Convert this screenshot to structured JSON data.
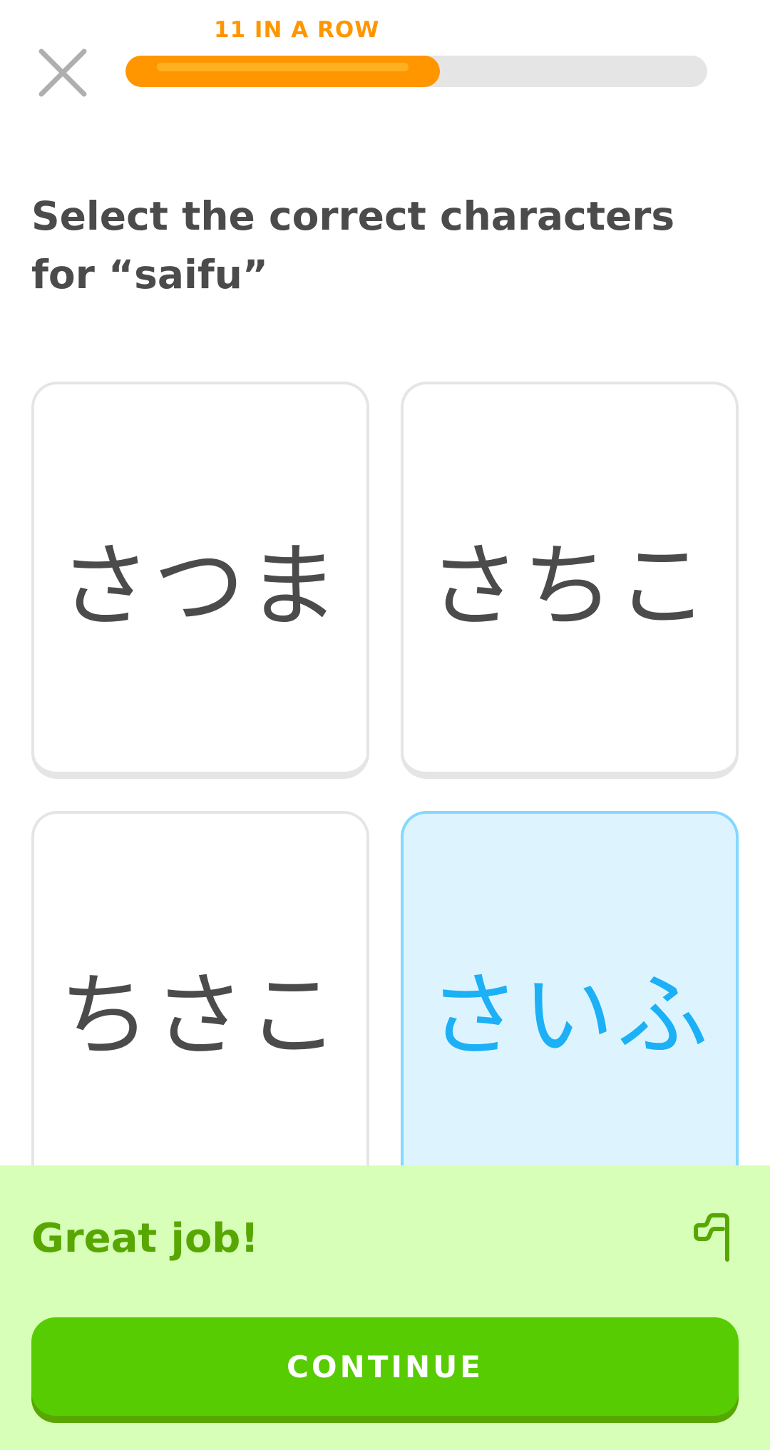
{
  "header": {
    "close_icon": "close-icon",
    "streak_label": "11 IN A ROW",
    "progress_fraction": 0.54,
    "streak_color": "#ff9600"
  },
  "prompt": {
    "text": "Select the correct characters for “saifu”"
  },
  "options": [
    {
      "text": "さつま",
      "selected": false
    },
    {
      "text": "さちこ",
      "selected": false
    },
    {
      "text": "ちさこ",
      "selected": false
    },
    {
      "text": "さいふ",
      "selected": true
    }
  ],
  "feedback": {
    "title": "Great job!",
    "report_icon": "flag-icon",
    "continue_label": "CONTINUE",
    "background_color": "#d7ffb8",
    "accent_color": "#58cc02"
  },
  "colors": {
    "selected_border": "#84d8ff",
    "selected_fill": "#ddf4ff",
    "selected_text": "#1cb0f6",
    "text_dark": "#4b4b4b"
  }
}
